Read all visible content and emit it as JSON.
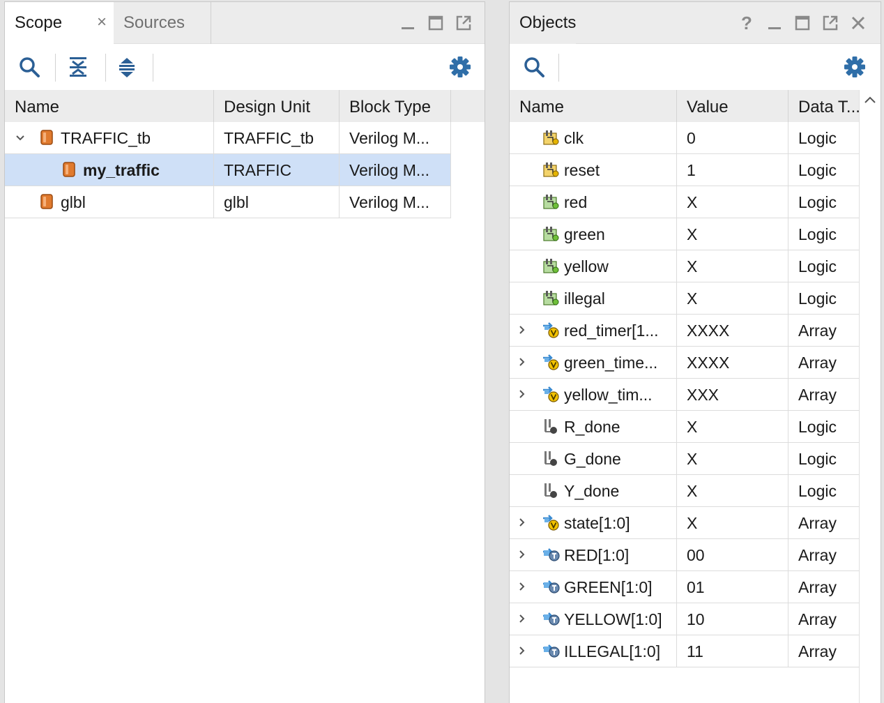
{
  "scope_panel": {
    "tabs": [
      {
        "label": "Scope",
        "active": true
      },
      {
        "label": "Sources",
        "active": false
      }
    ],
    "columns": [
      "Name",
      "Design Unit",
      "Block Type"
    ],
    "rows": [
      {
        "name": "TRAFFIC_tb",
        "design_unit": "TRAFFIC_tb",
        "block_type": "Verilog M...",
        "expanded": true,
        "level": 0,
        "selected": false
      },
      {
        "name": "my_traffic",
        "design_unit": "TRAFFIC",
        "block_type": "Verilog M...",
        "level": 1,
        "selected": true
      },
      {
        "name": "glbl",
        "design_unit": "glbl",
        "block_type": "Verilog M...",
        "level": 0,
        "selected": false
      }
    ]
  },
  "objects_panel": {
    "title": "Objects",
    "help_glyph": "?",
    "columns": [
      "Name",
      "Value",
      "Data T..."
    ],
    "rows": [
      {
        "name": "clk",
        "value": "0",
        "type": "Logic",
        "icon": "input-signal-icon",
        "expandable": false
      },
      {
        "name": "reset",
        "value": "1",
        "type": "Logic",
        "icon": "input-signal-icon",
        "expandable": false
      },
      {
        "name": "red",
        "value": "X",
        "type": "Logic",
        "icon": "output-signal-icon",
        "expandable": false
      },
      {
        "name": "green",
        "value": "X",
        "type": "Logic",
        "icon": "output-signal-icon",
        "expandable": false
      },
      {
        "name": "yellow",
        "value": "X",
        "type": "Logic",
        "icon": "output-signal-icon",
        "expandable": false
      },
      {
        "name": "illegal",
        "value": "X",
        "type": "Logic",
        "icon": "output-signal-icon",
        "expandable": false
      },
      {
        "name": "red_timer[1...",
        "value": "XXXX",
        "type": "Array",
        "icon": "variable-icon",
        "expandable": true
      },
      {
        "name": "green_time...",
        "value": "XXXX",
        "type": "Array",
        "icon": "variable-icon",
        "expandable": true
      },
      {
        "name": "yellow_tim...",
        "value": "XXX",
        "type": "Array",
        "icon": "variable-icon",
        "expandable": true
      },
      {
        "name": "R_done",
        "value": "X",
        "type": "Logic",
        "icon": "internal-signal-icon",
        "expandable": false
      },
      {
        "name": "G_done",
        "value": "X",
        "type": "Logic",
        "icon": "internal-signal-icon",
        "expandable": false
      },
      {
        "name": "Y_done",
        "value": "X",
        "type": "Logic",
        "icon": "internal-signal-icon",
        "expandable": false
      },
      {
        "name": "state[1:0]",
        "value": "X",
        "type": "Array",
        "icon": "variable-icon",
        "expandable": true
      },
      {
        "name": "RED[1:0]",
        "value": "00",
        "type": "Array",
        "icon": "constant-icon",
        "expandable": true
      },
      {
        "name": "GREEN[1:0]",
        "value": "01",
        "type": "Array",
        "icon": "constant-icon",
        "expandable": true
      },
      {
        "name": "YELLOW[1:0]",
        "value": "10",
        "type": "Array",
        "icon": "constant-icon",
        "expandable": true
      },
      {
        "name": "ILLEGAL[1:0]",
        "value": "11",
        "type": "Array",
        "icon": "constant-icon",
        "expandable": true
      }
    ]
  },
  "colors": {
    "selection": "#cfe0f7",
    "module": "#e07a2e",
    "gear": "#2f6ea8",
    "header_bg": "#ececec"
  }
}
